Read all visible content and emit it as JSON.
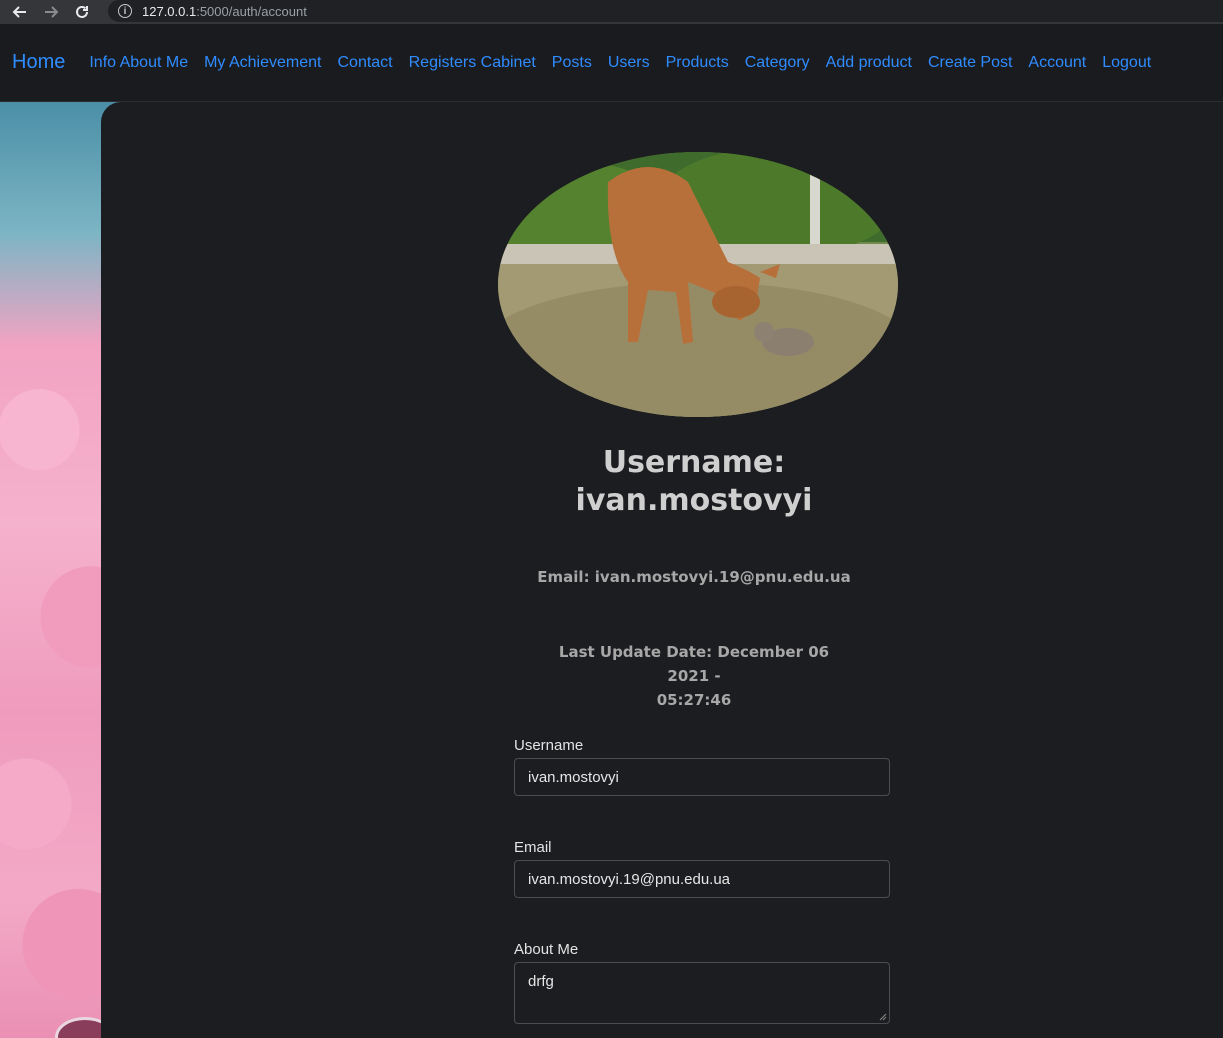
{
  "browser": {
    "url_host": "127.0.0.1",
    "url_path": ":5000/auth/account"
  },
  "navbar": {
    "brand": "Home",
    "links": [
      "Info About Me",
      "My Achievement",
      "Contact",
      "Registers Cabinet",
      "Posts",
      "Users",
      "Products",
      "Category",
      "Add product",
      "Create Post",
      "Account",
      "Logout"
    ]
  },
  "profile": {
    "username_heading_line1": "Username:",
    "username_heading_line2": "ivan.mostovyi",
    "email_line": "Email: ivan.mostovyi.19@pnu.edu.ua",
    "update_line1": "Last Update Date: December 06 2021 -",
    "update_line2": "05:27:46"
  },
  "form": {
    "username_label": "Username",
    "username_value": "ivan.mostovyi",
    "email_label": "Email",
    "email_value": "ivan.mostovyi.19@pnu.edu.ua",
    "about_label": "About Me",
    "about_value": "drfg"
  },
  "colors": {
    "link": "#2f8cff",
    "background": "#1c1d20"
  }
}
